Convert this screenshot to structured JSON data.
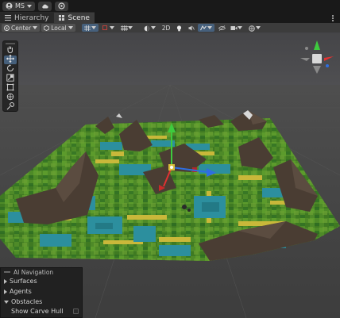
{
  "topbar": {
    "account_label": "MS",
    "cloud_icon": "cloud-icon",
    "settings_icon": "gear-icon"
  },
  "tabs": [
    {
      "label": "Hierarchy",
      "icon": "list-icon"
    },
    {
      "label": "Scene",
      "icon": "grid-icon"
    }
  ],
  "toolbar": {
    "pivot_label": "Center",
    "space_label": "Local",
    "mode_2d_label": "2D"
  },
  "ai_navigation": {
    "title": "AI Navigation",
    "items": [
      {
        "label": "Surfaces",
        "expanded": false
      },
      {
        "label": "Agents",
        "expanded": false
      },
      {
        "label": "Obstacles",
        "expanded": true
      }
    ],
    "obstacles_option": "Show Carve Hull"
  },
  "colors": {
    "toolbar_bg": "#3c3c3c",
    "active_tool": "#46607c",
    "grass": "#4f8a2a",
    "water": "#2c8f9e",
    "sand": "#c9b83a",
    "mountain": "#4a3d33"
  }
}
